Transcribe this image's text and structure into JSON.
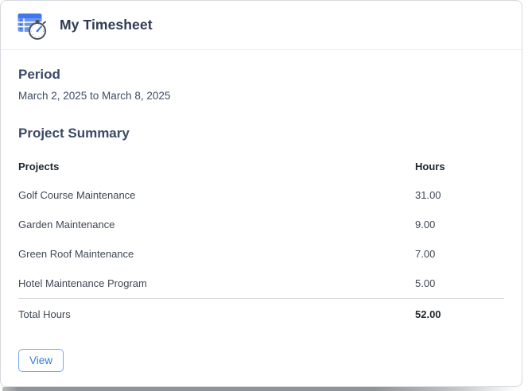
{
  "header": {
    "title": "My Timesheet",
    "icon": "timesheet-stopwatch-icon"
  },
  "period": {
    "heading": "Period",
    "range": "March 2, 2025 to March 8, 2025"
  },
  "summary": {
    "heading": "Project Summary",
    "table": {
      "columns": [
        "Projects",
        "Hours"
      ],
      "rows": [
        {
          "project": "Golf Course Maintenance",
          "hours": "31.00"
        },
        {
          "project": "Garden Maintenance",
          "hours": "9.00"
        },
        {
          "project": "Green Roof Maintenance",
          "hours": "7.00"
        },
        {
          "project": "Hotel Maintenance Program",
          "hours": "5.00"
        }
      ],
      "total": {
        "label": "Total Hours",
        "hours": "52.00"
      }
    }
  },
  "actions": {
    "view_label": "View"
  },
  "colors": {
    "accent_blue": "#2b7cea",
    "button_border": "#79a7f2",
    "heading_navy": "#3b4a64",
    "title_navy": "#2e3a52",
    "table_text": "#3f4854",
    "table_header_text": "#1f262d",
    "card_border": "#d5d8dc",
    "separator": "#d6d9dc",
    "icon_blue_dark": "#4076ee",
    "icon_blue_light": "#6b97f2"
  }
}
